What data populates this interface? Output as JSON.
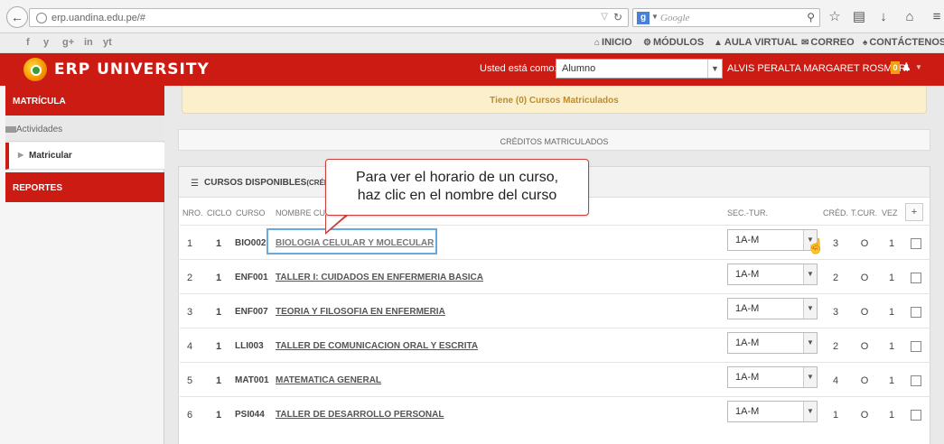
{
  "browser": {
    "url": "erp.uandina.edu.pe/#",
    "search_placeholder": "Google"
  },
  "toplinks": {
    "social": [
      "f",
      "y",
      "g+",
      "in",
      "yt"
    ],
    "inicio": "INICIO",
    "modulos": "MÓDULOS",
    "aula_virtual": "AULA VIRTUAL",
    "correo": "CORREO",
    "contactenos": "CONTÁCTENOS"
  },
  "header": {
    "logo_text": "ERP UNIVERSITY",
    "role_label": "Usted está como:",
    "role_value": "Alumno",
    "user_name": "ALVIS PERALTA MARGARET ROSMERI",
    "notif_count": "0"
  },
  "sidebar": {
    "matricula": "MATRÍCULA",
    "actividades": "Actividades",
    "matricular": "Matricular",
    "reportes": "REPORTES"
  },
  "main": {
    "alert": "Tiene (0) Cursos Matriculados",
    "creditos": "CRÉDITOS MATRICULADOS",
    "cursos_title": "CURSOS DISPONIBLES",
    "cursos_title_suffix": "(CRÉD",
    "columns": {
      "nro": "NRO.",
      "ciclo": "CICLO",
      "curso": "CURSO",
      "nombre": "NOMBRE CUR",
      "sec_tur": "SEC.-TUR.",
      "cred": "CRÉD.",
      "tcur": "T.CUR.",
      "vez": "VEZ",
      "add": "+"
    }
  },
  "callout": {
    "line1": "Para ver el horario de un curso,",
    "line2": "haz clic en el nombre del curso"
  },
  "courses": [
    {
      "nro": "1",
      "ciclo": "1",
      "codigo": "BIO002",
      "nombre": "BIOLOGIA CELULAR Y MOLECULAR",
      "seccion": "1A-M",
      "cred": "3",
      "tcur": "O",
      "vez": "1"
    },
    {
      "nro": "2",
      "ciclo": "1",
      "codigo": "ENF001",
      "nombre": "TALLER I: CUIDADOS EN ENFERMERIA BASICA",
      "seccion": "1A-M",
      "cred": "2",
      "tcur": "O",
      "vez": "1"
    },
    {
      "nro": "3",
      "ciclo": "1",
      "codigo": "ENF007",
      "nombre": "TEORIA Y FILOSOFIA EN ENFERMERIA",
      "seccion": "1A-M",
      "cred": "3",
      "tcur": "O",
      "vez": "1"
    },
    {
      "nro": "4",
      "ciclo": "1",
      "codigo": "LLI003",
      "nombre": "TALLER DE COMUNICACION ORAL Y ESCRITA",
      "seccion": "1A-M",
      "cred": "2",
      "tcur": "O",
      "vez": "1"
    },
    {
      "nro": "5",
      "ciclo": "1",
      "codigo": "MAT001",
      "nombre": "MATEMATICA GENERAL",
      "seccion": "1A-M",
      "cred": "4",
      "tcur": "O",
      "vez": "1"
    },
    {
      "nro": "6",
      "ciclo": "1",
      "codigo": "PSI044",
      "nombre": "TALLER DE DESARROLLO PERSONAL",
      "seccion": "1A-M",
      "cred": "1",
      "tcur": "O",
      "vez": "1"
    }
  ],
  "colors": {
    "brand_red": "#cc1b12",
    "alert_bg": "#fcf0cc",
    "highlight": "#6aa8e0"
  }
}
